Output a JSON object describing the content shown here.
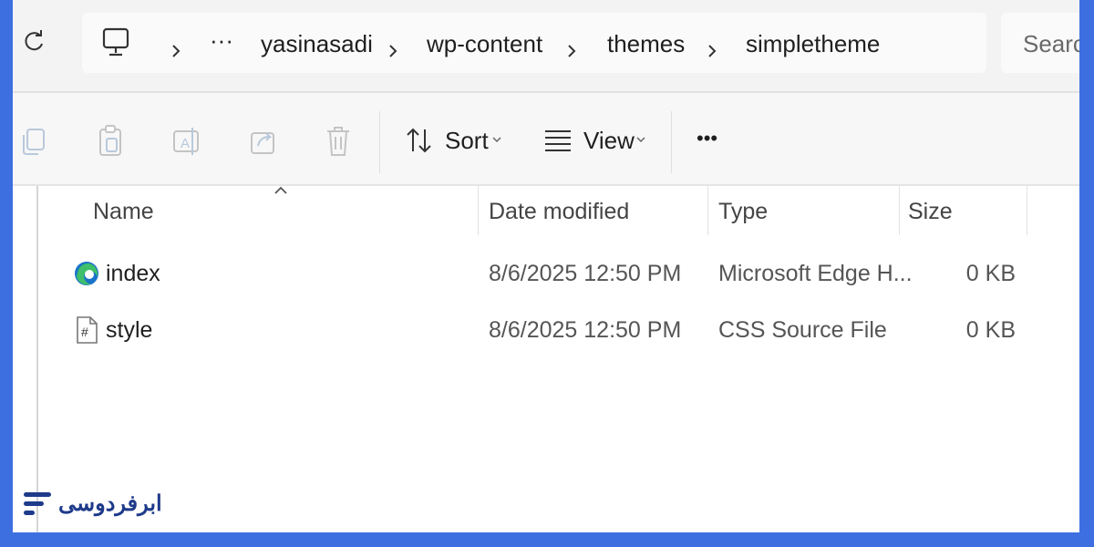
{
  "address_bar": {
    "overflow_label": "···",
    "breadcrumbs": [
      "yasinasadi",
      "wp-content",
      "themes",
      "simpletheme"
    ],
    "search_placeholder": "Search"
  },
  "toolbar": {
    "sort_label": "Sort",
    "view_label": "View",
    "more_label": "•••"
  },
  "columns": {
    "name": "Name",
    "date_modified": "Date modified",
    "type": "Type",
    "size": "Size"
  },
  "files": [
    {
      "name": "index",
      "date_modified": "8/6/2025 12:50 PM",
      "type": "Microsoft Edge H...",
      "size": "0 KB",
      "icon": "edge-html-icon"
    },
    {
      "name": "style",
      "date_modified": "8/6/2025 12:50 PM",
      "type": "CSS Source File",
      "size": "0 KB",
      "icon": "css-file-icon"
    }
  ],
  "watermark": {
    "text": "ابرفردوسی"
  },
  "colors": {
    "frame_border": "#3d6fe0",
    "edge_blue": "#1a73c8",
    "edge_green": "#3fbf6a"
  }
}
